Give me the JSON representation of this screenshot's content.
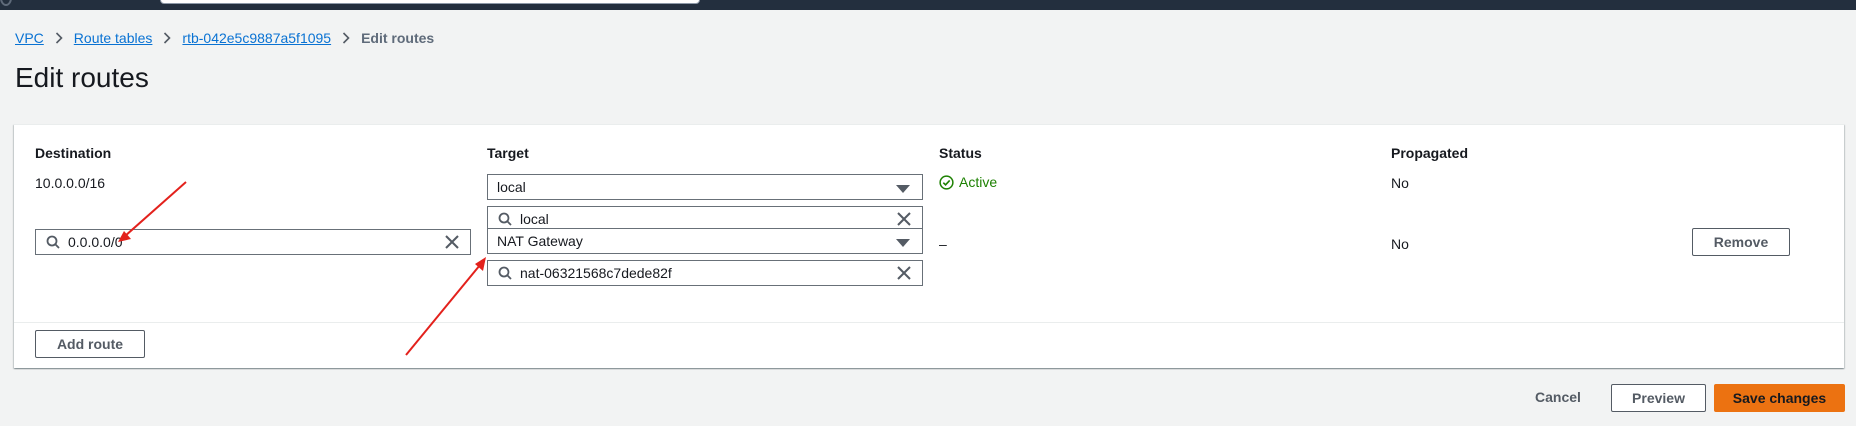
{
  "breadcrumb": {
    "items": [
      {
        "label": "VPC"
      },
      {
        "label": "Route tables"
      },
      {
        "label": "rtb-042e5c9887a5f1095"
      }
    ],
    "current": "Edit routes"
  },
  "page": {
    "title": "Edit routes"
  },
  "table": {
    "headers": {
      "destination": "Destination",
      "target": "Target",
      "status": "Status",
      "propagated": "Propagated"
    },
    "rows": [
      {
        "destination": "10.0.0.0/16",
        "target_type": "local",
        "target_value": "local",
        "status": "Active",
        "propagated": "No"
      },
      {
        "destination": "0.0.0.0/0",
        "target_type": "NAT Gateway",
        "target_value": "nat-06321568c7dede82f",
        "status": "–",
        "propagated": "No",
        "remove_label": "Remove"
      }
    ]
  },
  "actions": {
    "add_route": "Add route",
    "cancel": "Cancel",
    "preview": "Preview",
    "save": "Save changes"
  },
  "colors": {
    "link": "#0972d3",
    "success": "#1d8102",
    "primary": "#ec7211",
    "annotation_arrow": "#e3211c"
  }
}
